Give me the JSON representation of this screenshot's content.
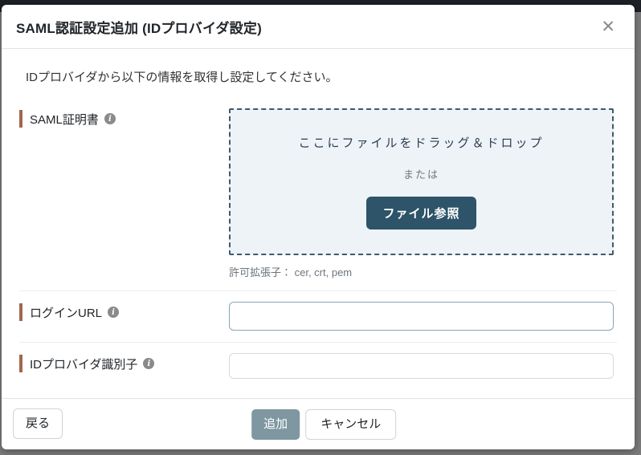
{
  "header": {
    "title": "SAML認証設定追加 (IDプロバイダ設定)",
    "close_icon": "✕"
  },
  "body": {
    "instruction": "IDプロバイダから以下の情報を取得し設定してください。",
    "certificate": {
      "label": "SAML証明書",
      "dropzone": {
        "drag_text": "ここにファイルをドラッグ＆ドロップ",
        "or_text": "または",
        "browse_button_label": "ファイル参照"
      },
      "allowed_extensions_note": "許可拡張子： cer, crt, pem"
    },
    "login_url": {
      "label": "ログインURL",
      "value": "",
      "placeholder": ""
    },
    "idp_identifier": {
      "label": "IDプロバイダ識別子",
      "value": "",
      "placeholder": ""
    }
  },
  "footer": {
    "back_button_label": "戻る",
    "add_button_label": "追加",
    "cancel_button_label": "キャンセル"
  },
  "icons": {
    "info_glyph": "i"
  },
  "colors": {
    "accent_teal": "#2d5468",
    "muted_teal_button": "#7e97a1",
    "label_bar_sienna": "#a0674e",
    "dropzone_bg": "#eef3f8",
    "dropzone_border": "#3e5a6d",
    "backdrop_gray": "#7b7b7b",
    "backdrop_top_dark": "#1d2126"
  }
}
